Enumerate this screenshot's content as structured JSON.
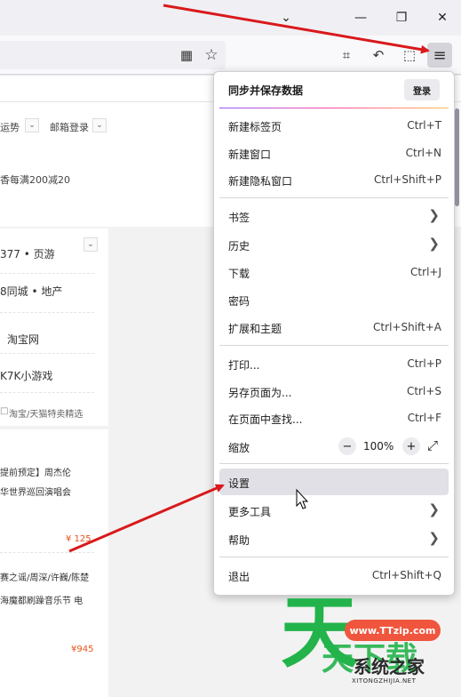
{
  "window": {
    "minimize_glyph": "—",
    "restore_glyph": "❐",
    "close_glyph": "✕",
    "tabs_dropdown_glyph": "⌄"
  },
  "toolbar": {
    "qr_glyph": "▦",
    "star_glyph": "☆",
    "crop_glyph": "⌗",
    "back_glyph": "↶",
    "extensions_glyph": "⬚",
    "menu_glyph": "≡"
  },
  "page": {
    "tags": [
      "运势",
      "邮箱登录"
    ],
    "promo": "香每满200减20",
    "sites": [
      "377 • 页游",
      "8同城 • 地产",
      "淘宝网",
      "K7K小游戏"
    ],
    "taobao_note": "淘宝/天猫特卖精选",
    "news1": [
      "提前预定】周杰伦",
      "华世界巡回演唱会"
    ],
    "price1": "¥ 125",
    "news2": [
      "赛之谣/周深/许巍/陈楚",
      "海魔都刷躁音乐节 电"
    ],
    "price2": "¥945"
  },
  "menu": {
    "sync_title": "同步并保存数据",
    "login": "登录",
    "new_tab": {
      "label": "新建标签页",
      "shortcut": "Ctrl+T"
    },
    "new_window": {
      "label": "新建窗口",
      "shortcut": "Ctrl+N"
    },
    "new_private": {
      "label": "新建隐私窗口",
      "shortcut": "Ctrl+Shift+P"
    },
    "bookmarks": {
      "label": "书签"
    },
    "history": {
      "label": "历史"
    },
    "downloads": {
      "label": "下载",
      "shortcut": "Ctrl+J"
    },
    "passwords": {
      "label": "密码"
    },
    "addons": {
      "label": "扩展和主题",
      "shortcut": "Ctrl+Shift+A"
    },
    "print": {
      "label": "打印...",
      "shortcut": "Ctrl+P"
    },
    "save_page": {
      "label": "另存页面为...",
      "shortcut": "Ctrl+S"
    },
    "find": {
      "label": "在页面中查找...",
      "shortcut": "Ctrl+F"
    },
    "zoom": {
      "label": "缩放",
      "value": "100%",
      "minus": "−",
      "plus": "+",
      "fullscreen_glyph": "⤢"
    },
    "settings": {
      "label": "设置"
    },
    "more_tools": {
      "label": "更多工具"
    },
    "help": {
      "label": "帮助"
    },
    "exit": {
      "label": "退出",
      "shortcut": "Ctrl+Shift+Q"
    },
    "submenu_glyph": "❯"
  },
  "watermark": {
    "url": "www.TTzip.com",
    "big_char_1": "天",
    "big_chars_2": "天下载",
    "logo_text": "系统之家",
    "domain": "XITONGZHIJIA.NET"
  },
  "colors": {
    "accent": "#9059ff",
    "arrow": "#d9191c",
    "price": "#e8531a",
    "watermark_green": "#23b34b"
  }
}
